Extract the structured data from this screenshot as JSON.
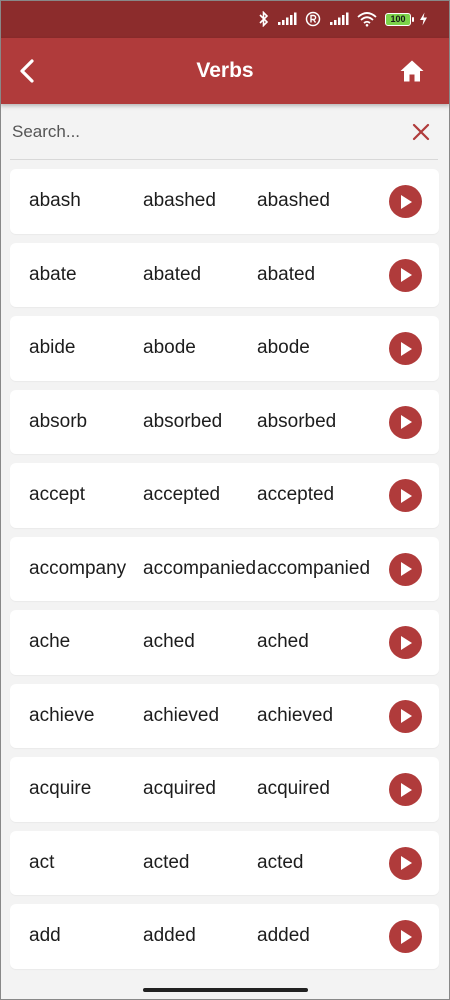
{
  "status_bar": {
    "battery_level": "100",
    "icons": [
      "bluetooth-icon",
      "signal-icon",
      "registered-icon",
      "signal-icon",
      "wifi-icon",
      "battery-icon",
      "charging-icon"
    ]
  },
  "header": {
    "title": "Verbs",
    "back_icon": "chevron-left-icon",
    "home_icon": "home-icon",
    "color": "#b03b3b"
  },
  "search": {
    "placeholder": "Search...",
    "value": "",
    "clear_icon": "close-icon"
  },
  "verbs": [
    {
      "base": "abash",
      "past": "abashed",
      "participle": "abashed"
    },
    {
      "base": "abate",
      "past": "abated",
      "participle": "abated"
    },
    {
      "base": "abide",
      "past": "abode",
      "participle": "abode"
    },
    {
      "base": "absorb",
      "past": "absorbed",
      "participle": "absorbed"
    },
    {
      "base": "accept",
      "past": "accepted",
      "participle": "accepted"
    },
    {
      "base": "accompany",
      "past": "accompanied",
      "participle": "accompanied"
    },
    {
      "base": "ache",
      "past": "ached",
      "participle": "ached"
    },
    {
      "base": "achieve",
      "past": "achieved",
      "participle": "achieved"
    },
    {
      "base": "acquire",
      "past": "acquired",
      "participle": "acquired"
    },
    {
      "base": "act",
      "past": "acted",
      "participle": "acted"
    },
    {
      "base": "add",
      "past": "added",
      "participle": "added"
    }
  ],
  "play_icon": "play-icon"
}
